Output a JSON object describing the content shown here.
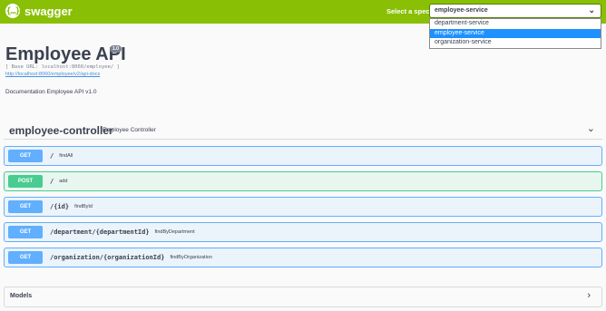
{
  "topbar": {
    "logo_icon": "{…}",
    "logo_text": "swagger",
    "spec_label": "Select a spec",
    "spec_selected": "employee-service",
    "spec_options": [
      "department-service",
      "employee-service",
      "organization-service"
    ]
  },
  "info": {
    "title": "Employee API",
    "version": "1.0",
    "base_url": "[ Base URL: localhost:8060/employee/ ]",
    "docs_link": "http://localhost:8060/employee/v2/api-docs",
    "description": "Documentation Employee API v1.0"
  },
  "tag": {
    "name": "employee-controller",
    "description": "Employee Controller",
    "toggle_icon": "⌄"
  },
  "operations": [
    {
      "method": "GET",
      "path": "/",
      "summary": "findAll"
    },
    {
      "method": "POST",
      "path": "/",
      "summary": "add"
    },
    {
      "method": "GET",
      "path": "/{id}",
      "summary": "findById"
    },
    {
      "method": "GET",
      "path": "/department/{departmentId}",
      "summary": "findByDepartment"
    },
    {
      "method": "GET",
      "path": "/organization/{organizationId}",
      "summary": "findByOrganization"
    }
  ],
  "models": {
    "title": "Models",
    "toggle_icon": "›"
  },
  "colors": {
    "topbar": "#89bf04",
    "get": "#61affe",
    "post": "#49cc90"
  }
}
